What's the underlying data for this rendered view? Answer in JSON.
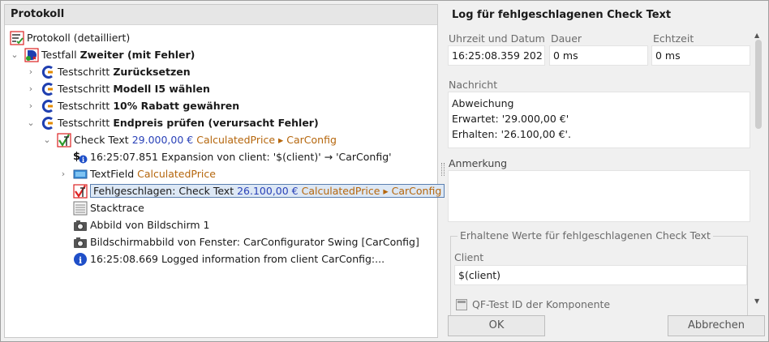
{
  "left": {
    "header": "Protokoll",
    "tree": [
      {
        "kind": "protocol",
        "label": "Protokoll (detailliert)"
      },
      {
        "kind": "testcase",
        "prefix": "Testfall ",
        "bold": "Zweiter (mit Fehler)"
      },
      {
        "kind": "step",
        "prefix": "Testschritt ",
        "bold": "Zurücksetzen"
      },
      {
        "kind": "step",
        "prefix": "Testschritt ",
        "bold": "Modell I5 wählen"
      },
      {
        "kind": "step",
        "prefix": "Testschritt ",
        "bold": "10% Rabatt gewähren"
      },
      {
        "kind": "step",
        "prefix": "Testschritt ",
        "bold": "Endpreis prüfen (verursacht Fehler)"
      },
      {
        "kind": "check",
        "prefix": "Check Text ",
        "value": "29.000,00 €",
        "target": "CalculatedPrice ▸ CarConfig"
      },
      {
        "kind": "expansion",
        "label": "16:25:07.851 Expansion von client: '$(client)' → 'CarConfig'"
      },
      {
        "kind": "textfield",
        "prefix": "TextField ",
        "target": "CalculatedPrice"
      },
      {
        "kind": "failed",
        "prefix": "Fehlgeschlagen: Check Text ",
        "value": "26.100,00 €",
        "target": "CalculatedPrice ▸ CarConfig"
      },
      {
        "kind": "stacktrace",
        "label": "Stacktrace"
      },
      {
        "kind": "screenshot",
        "label": "Abbild von Bildschirm 1"
      },
      {
        "kind": "screenshot",
        "label": "Bildschirmabbild von Fenster: CarConfigurator Swing [CarConfig]"
      },
      {
        "kind": "info",
        "label": "16:25:08.669 Logged information from client CarConfig:..."
      }
    ]
  },
  "right": {
    "title": "Log für fehlgeschlagenen Check Text",
    "time_label": "Uhrzeit und Datum",
    "time_value": "16:25:08.359  202",
    "duration_label": "Dauer",
    "duration_value": "0 ms",
    "realtime_label": "Echtzeit",
    "realtime_value": "0 ms",
    "message_label": "Nachricht",
    "message_lines": [
      "Abweichung",
      "Erwartet: '29.000,00 €'",
      "Erhalten: '26.100,00 €'."
    ],
    "note_label": "Anmerkung",
    "note_value": "",
    "group_title": "Erhaltene Werte für fehlgeschlagenen Check Text",
    "client_label": "Client",
    "client_value": "$(client)",
    "component_label": "QF-Test ID der Komponente",
    "ok_label": "OK",
    "cancel_label": "Abbrechen"
  }
}
